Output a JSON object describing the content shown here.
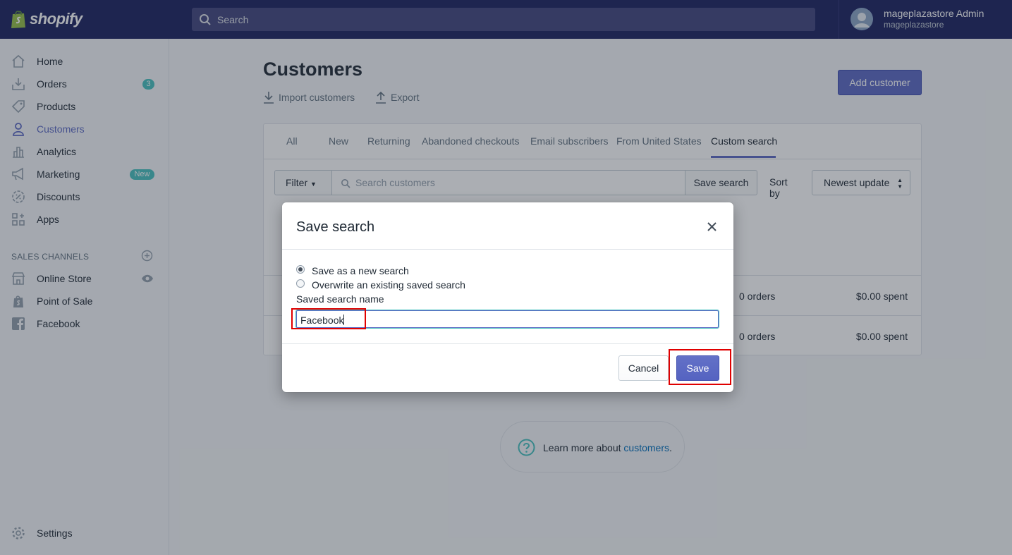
{
  "topbar": {
    "logo_text": "shopify",
    "search_placeholder": "Search",
    "account_name": "mageplazastore Admin",
    "account_store": "mageplazastore"
  },
  "sidebar": {
    "items": [
      {
        "label": "Home",
        "icon": "home-icon"
      },
      {
        "label": "Orders",
        "icon": "orders-icon",
        "badge": "3"
      },
      {
        "label": "Products",
        "icon": "tag-icon"
      },
      {
        "label": "Customers",
        "icon": "person-icon",
        "active": true
      },
      {
        "label": "Analytics",
        "icon": "bar-chart-icon"
      },
      {
        "label": "Marketing",
        "icon": "megaphone-icon",
        "badge": "New"
      },
      {
        "label": "Discounts",
        "icon": "discount-icon"
      },
      {
        "label": "Apps",
        "icon": "apps-icon"
      }
    ],
    "sales_channels_title": "SALES CHANNELS",
    "channels": [
      {
        "label": "Online Store",
        "icon": "store-icon"
      },
      {
        "label": "Point of Sale",
        "icon": "shopify-bag-icon"
      },
      {
        "label": "Facebook",
        "icon": "facebook-icon"
      }
    ],
    "settings_label": "Settings"
  },
  "main": {
    "title": "Customers",
    "import_label": "Import customers",
    "export_label": "Export",
    "add_customer_label": "Add customer",
    "tabs": [
      "All",
      "New",
      "Returning",
      "Abandoned checkouts",
      "Email subscribers",
      "From United States",
      "Custom search"
    ],
    "active_tab": "Custom search",
    "filter_label": "Filter",
    "search_placeholder": "Search customers",
    "save_search_label": "Save search",
    "sort_by_label": "Sort by",
    "sort_value": "Newest update",
    "rows": [
      {
        "orders": "0 orders",
        "spent": "$0.00 spent"
      },
      {
        "orders": "0 orders",
        "spent": "$0.00 spent"
      }
    ],
    "learn_more_text": "Learn more about ",
    "learn_more_link": "customers",
    "learn_more_period": "."
  },
  "modal": {
    "title": "Save search",
    "option_new": "Save as a new search",
    "option_overwrite": "Overwrite an existing saved search",
    "selected_option": "new",
    "field_label": "Saved search name",
    "field_value": "Facebook",
    "cancel_label": "Cancel",
    "save_label": "Save"
  },
  "colors": {
    "topbar": "#1c2260",
    "accent": "#5c6ac4",
    "badge": "#47c1bf",
    "highlight": "#e00000"
  }
}
